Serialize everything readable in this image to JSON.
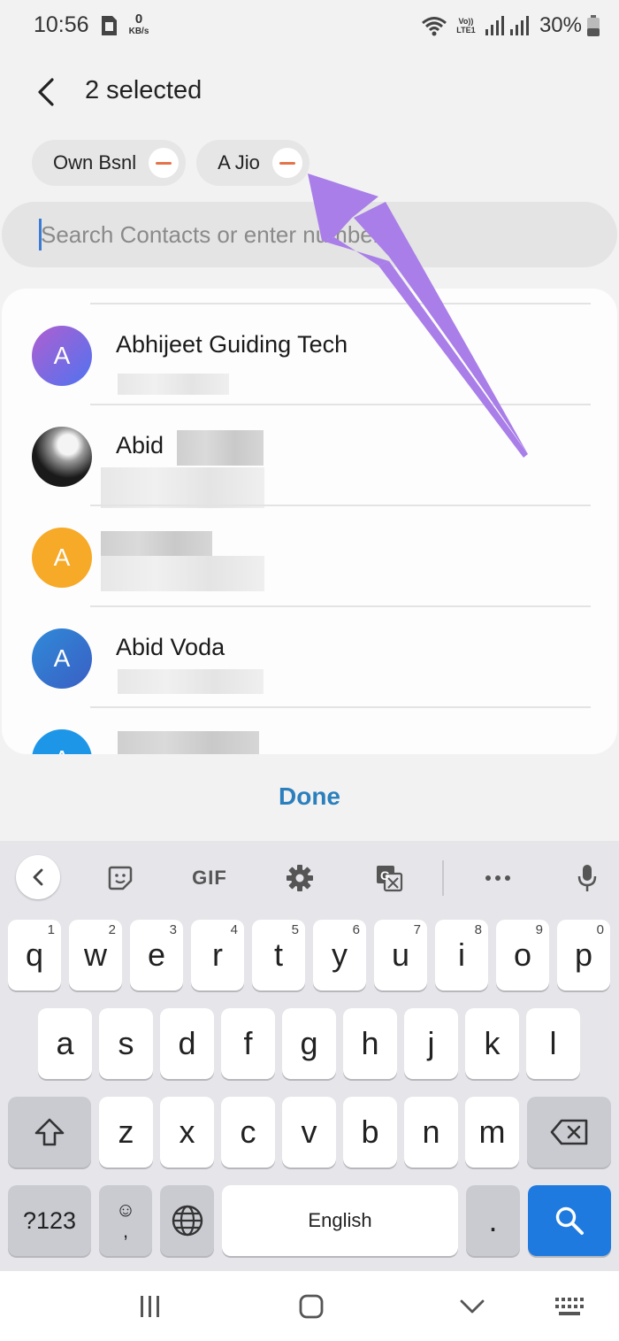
{
  "status_bar": {
    "time": "10:56",
    "data_rate_value": "0",
    "data_rate_unit": "KB/s",
    "network_label": "Vo)) LTE1",
    "battery": "30%"
  },
  "header": {
    "back_icon": "arrow-left-icon",
    "title": "2 selected"
  },
  "chips": [
    {
      "label": "Own Bsnl"
    },
    {
      "label": "A Jio"
    }
  ],
  "search": {
    "placeholder": "Search Contacts or enter number",
    "value": ""
  },
  "contacts": [
    {
      "initial": "A",
      "name": "Abhijeet Guiding Tech",
      "avatar_color": "#6b63e6"
    },
    {
      "initial": "",
      "name": "Abid",
      "avatar_color": "#222222"
    },
    {
      "initial": "A",
      "name": "",
      "avatar_color": "#f5a623"
    },
    {
      "initial": "A",
      "name": "Abid Voda",
      "avatar_color": "#3b7ed6"
    },
    {
      "initial": "A",
      "name": "",
      "avatar_color": "#1e96e8"
    }
  ],
  "done_label": "Done",
  "keyboard": {
    "toolbar": {
      "gif_label": "GIF",
      "icons": [
        "chevron-left-icon",
        "sticker-icon",
        "gif-icon",
        "gear-icon",
        "translate-icon",
        "more-icon",
        "microphone-icon"
      ]
    },
    "row1": [
      {
        "key": "q",
        "sup": "1"
      },
      {
        "key": "w",
        "sup": "2"
      },
      {
        "key": "e",
        "sup": "3"
      },
      {
        "key": "r",
        "sup": "4"
      },
      {
        "key": "t",
        "sup": "5"
      },
      {
        "key": "y",
        "sup": "6"
      },
      {
        "key": "u",
        "sup": "7"
      },
      {
        "key": "i",
        "sup": "8"
      },
      {
        "key": "o",
        "sup": "9"
      },
      {
        "key": "p",
        "sup": "0"
      }
    ],
    "row2": [
      "a",
      "s",
      "d",
      "f",
      "g",
      "h",
      "j",
      "k",
      "l"
    ],
    "row3": [
      "z",
      "x",
      "c",
      "v",
      "b",
      "n",
      "m"
    ],
    "row4": {
      "symbols_label": "?123",
      "emoji_top": "☺",
      "emoji_bottom": ",",
      "space_label": "English",
      "period": "."
    }
  },
  "colors": {
    "accent": "#2b7fbd",
    "chip_remove": "#e5734a",
    "annotation_arrow": "#a97ee8",
    "search_key": "#1f7ae0"
  }
}
